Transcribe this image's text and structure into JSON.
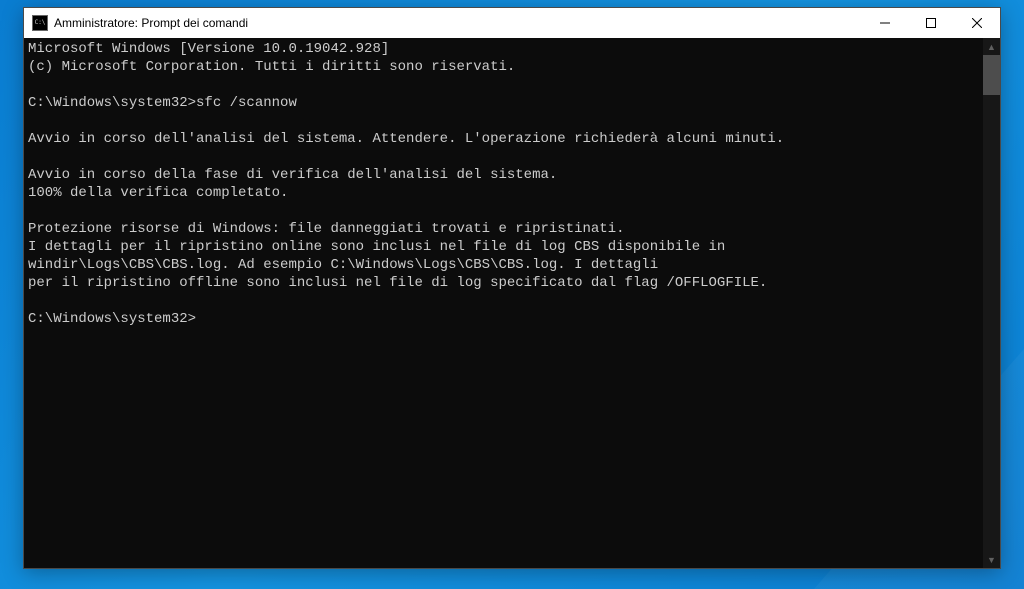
{
  "window": {
    "title": "Amministratore: Prompt dei comandi"
  },
  "terminal": {
    "lines": [
      "Microsoft Windows [Versione 10.0.19042.928]",
      "(c) Microsoft Corporation. Tutti i diritti sono riservati.",
      "",
      "C:\\Windows\\system32>sfc /scannow",
      "",
      "Avvio in corso dell'analisi del sistema. Attendere. L'operazione richiederà alcuni minuti.",
      "",
      "Avvio in corso della fase di verifica dell'analisi del sistema.",
      "100% della verifica completato.",
      "",
      "Protezione risorse di Windows: file danneggiati trovati e ripristinati.",
      "I dettagli per il ripristino online sono inclusi nel file di log CBS disponibile in",
      "windir\\Logs\\CBS\\CBS.log. Ad esempio C:\\Windows\\Logs\\CBS\\CBS.log. I dettagli",
      "per il ripristino offline sono inclusi nel file di log specificato dal flag /OFFLOGFILE.",
      ""
    ],
    "current_prompt": "C:\\Windows\\system32>"
  }
}
